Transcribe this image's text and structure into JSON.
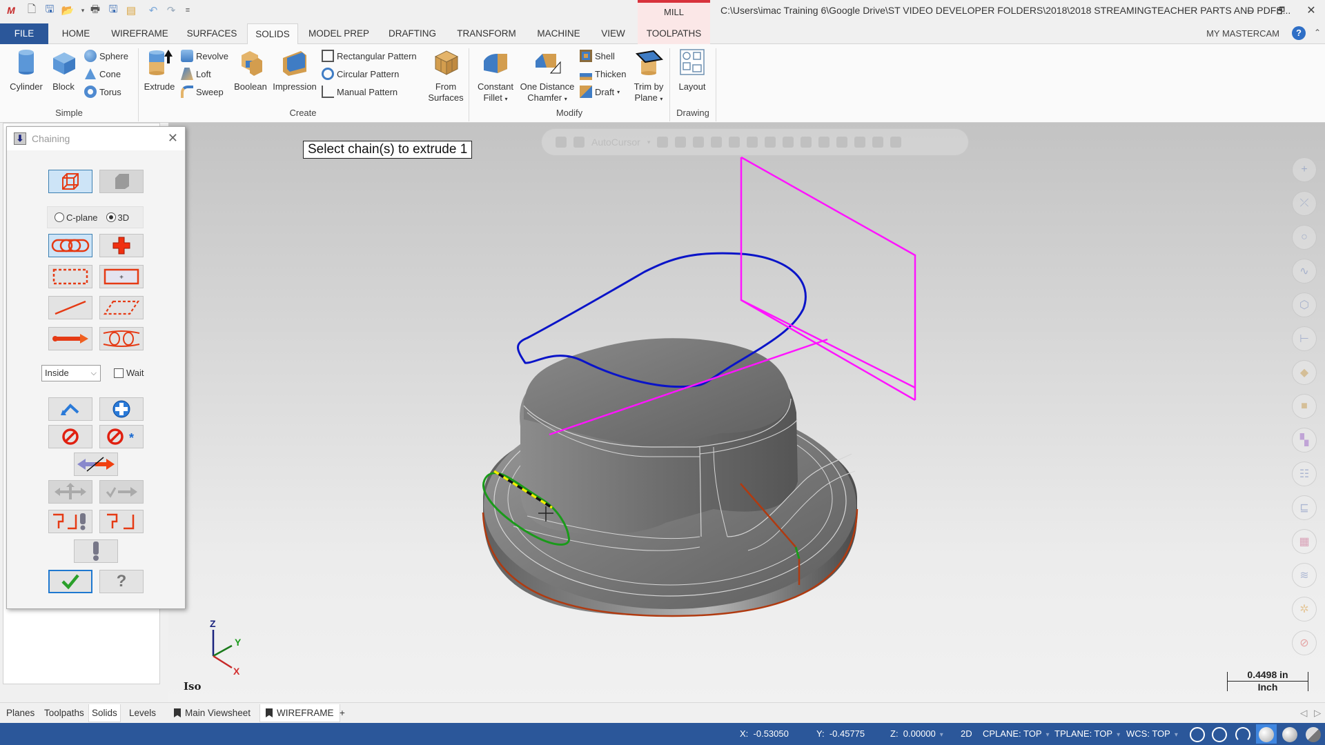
{
  "title_bar": {
    "app_logo": "mastercam-2018-logo",
    "quick_access": [
      "new-file-icon",
      "save-icon",
      "open-icon",
      "print-icon",
      "save-as-icon",
      "zip2go-icon",
      "undo-icon",
      "redo-icon",
      "customize-icon"
    ],
    "context_tab": "MILL",
    "path": "C:\\Users\\imac Training 6\\Google Drive\\ST VIDEO DEVELOPER FOLDERS\\2018\\2018 STREAMINGTEACHER PARTS AND PDFS...",
    "window_buttons": {
      "minimize": "–",
      "restore": "🗗",
      "close": "✕"
    }
  },
  "tabs": [
    {
      "label": "FILE"
    },
    {
      "label": "HOME"
    },
    {
      "label": "WIREFRAME"
    },
    {
      "label": "SURFACES"
    },
    {
      "label": "SOLIDS",
      "active": true
    },
    {
      "label": "MODEL PREP"
    },
    {
      "label": "DRAFTING"
    },
    {
      "label": "TRANSFORM"
    },
    {
      "label": "MACHINE"
    },
    {
      "label": "VIEW"
    },
    {
      "label": "TOOLPATHS"
    }
  ],
  "my_mastercam": "MY MASTERCAM",
  "help_icon": "?",
  "ribbon": {
    "groups": {
      "simple": "Simple",
      "create": "Create",
      "modify": "Modify",
      "drawing": "Drawing"
    },
    "simple": {
      "cylinder": "Cylinder",
      "block": "Block",
      "sphere": "Sphere",
      "cone": "Cone",
      "torus": "Torus"
    },
    "create": {
      "extrude": "Extrude",
      "revolve": "Revolve",
      "loft": "Loft",
      "sweep": "Sweep",
      "boolean": "Boolean",
      "impression": "Impression",
      "rect_pattern": "Rectangular Pattern",
      "circ_pattern": "Circular Pattern",
      "manual_pattern": "Manual Pattern",
      "from_surfaces_1": "From",
      "from_surfaces_2": "Surfaces"
    },
    "modify": {
      "fillet_1": "Constant",
      "fillet_2": "Fillet",
      "chamfer_1": "One Distance",
      "chamfer_2": "Chamfer",
      "shell": "Shell",
      "thicken": "Thicken",
      "draft": "Draft",
      "trim_1": "Trim by",
      "trim_2": "Plane"
    },
    "drawing": {
      "layout": "Layout"
    }
  },
  "chaining_dialog": {
    "title": "Chaining",
    "close": "✕",
    "mode_options": [
      {
        "label": "C-plane",
        "selected": false
      },
      {
        "label": "3D",
        "selected": true
      }
    ],
    "selection_buttons": [
      "wireframe-chain",
      "solid-chain",
      "chain",
      "point",
      "window",
      "area",
      "single",
      "polygon",
      "vector",
      "partial"
    ],
    "window_option": "Inside",
    "wait_label": "Wait",
    "wait_checked": false,
    "action_buttons": [
      "last",
      "select-more",
      "unselect",
      "unselect-all",
      "reverse",
      "move-start",
      "end-point",
      "options",
      "options-reset",
      "cancel-warning",
      "ok",
      "help"
    ]
  },
  "viewport": {
    "prompt": "Select chain(s) to extrude 1",
    "autocursor": "AutoCursor",
    "view_name": "Iso",
    "axes": {
      "z": "Z",
      "y": "Y",
      "x": "X"
    },
    "scale": {
      "value": "0.4498 in",
      "unit": "Inch"
    },
    "colors": {
      "sketch_blue": "#0a14c8",
      "plane_magenta": "#ff14ff",
      "selected_green": "#1a9a1a",
      "edge_brown": "#b03a10"
    },
    "right_rail": [
      "point-icon",
      "line-icon",
      "arc-icon",
      "spline-icon",
      "solid-icon",
      "dimension-icon",
      "surface-icon",
      "box-icon",
      "color-icon",
      "layer-list-icon",
      "attribute-icon",
      "palette-icon",
      "layers-icon",
      "settings-icon",
      "clear-icon"
    ]
  },
  "bottom_tabs": {
    "manager": [
      {
        "label": "Planes"
      },
      {
        "label": "Toolpaths"
      },
      {
        "label": "Solids",
        "active": true
      },
      {
        "label": "Levels"
      }
    ],
    "viewsheets": [
      {
        "label": "Main Viewsheet"
      },
      {
        "label": "WIREFRAME",
        "active": true
      }
    ],
    "add": "+"
  },
  "status_bar": {
    "x": {
      "label": "X:",
      "value": "-0.53050"
    },
    "y": {
      "label": "Y:",
      "value": "-0.45775"
    },
    "z": {
      "label": "Z:",
      "value": "0.00000"
    },
    "mode": "2D",
    "cplane": "CPLANE: TOP",
    "tplane": "TPLANE: TOP",
    "wcs": "WCS: TOP"
  }
}
